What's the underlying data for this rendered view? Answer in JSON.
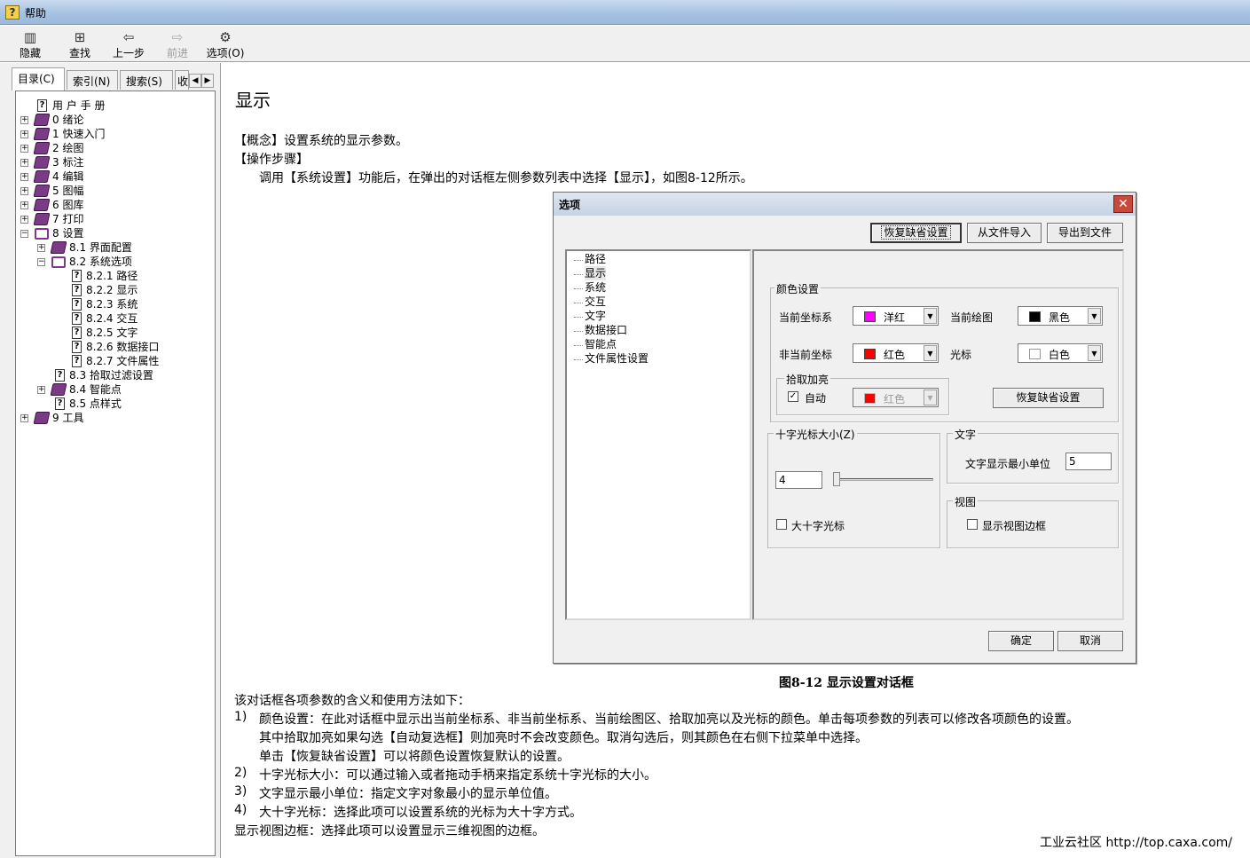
{
  "window": {
    "title": "帮助"
  },
  "toolbar": {
    "hide": "隐藏",
    "find": "查找",
    "back": "上一步",
    "forward": "前进",
    "options": "选项(O)"
  },
  "left_tabs": {
    "contents": "目录(C)",
    "index": "索引(N)",
    "search": "搜索(S)",
    "favorites": "收"
  },
  "tree": [
    {
      "label": "用 户 手 册"
    },
    {
      "label": "0 绪论"
    },
    {
      "label": "1 快速入门"
    },
    {
      "label": "2 绘图"
    },
    {
      "label": "3 标注"
    },
    {
      "label": "4 编辑"
    },
    {
      "label": "5 图幅"
    },
    {
      "label": "6 图库"
    },
    {
      "label": "7 打印"
    },
    {
      "label": "8 设置"
    },
    {
      "label": "8.1 界面配置"
    },
    {
      "label": "8.2 系统选项"
    },
    {
      "label": "8.2.1 路径"
    },
    {
      "label": "8.2.2 显示"
    },
    {
      "label": "8.2.3 系统"
    },
    {
      "label": "8.2.4 交互"
    },
    {
      "label": "8.2.5 文字"
    },
    {
      "label": "8.2.6 数据接口"
    },
    {
      "label": "8.2.7 文件属性"
    },
    {
      "label": "8.3 拾取过滤设置"
    },
    {
      "label": "8.4 智能点"
    },
    {
      "label": "8.5 点样式"
    },
    {
      "label": "9 工具"
    }
  ],
  "page": {
    "title": "显示",
    "concept": "【概念】设置系统的显示参数。",
    "steps_head": "【操作步骤】",
    "steps_text": "调用【系统设置】功能后，在弹出的对话框左侧参数列表中选择【显示】，如图8-12所示。",
    "figure_caption": "图8-12 显示设置对话框",
    "intro": "该对话框各项参数的含义和使用方法如下：",
    "items": [
      {
        "num": "1)",
        "text": "颜色设置：在此对话框中显示出当前坐标系、非当前坐标系、当前绘图区、拾取加亮以及光标的颜色。单击每项参数的列表可以修改各项颜色的设置。"
      },
      {
        "num": "",
        "text": "其中拾取加亮如果勾选【自动复选框】则加亮时不会改变颜色。取消勾选后，则其颜色在右侧下拉菜单中选择。"
      },
      {
        "num": "",
        "text": "单击【恢复缺省设置】可以将颜色设置恢复默认的设置。"
      },
      {
        "num": "2)",
        "text": "十字光标大小：可以通过输入或者拖动手柄来指定系统十字光标的大小。"
      },
      {
        "num": "3)",
        "text": "文字显示最小单位：指定文字对象最小的显示单位值。"
      },
      {
        "num": "4)",
        "text": "大十字光标：选择此项可以设置系统的光标为大十字方式。"
      }
    ],
    "last_line": "显示视图边框：选择此项可以设置显示三维视图的边框。",
    "watermark": "工业云社区 http://top.caxa.com/"
  },
  "dialog": {
    "title": "选项",
    "restore_defaults": "恢复缺省设置",
    "import": "从文件导入",
    "export": "导出到文件",
    "list": [
      "路径",
      "显示",
      "系统",
      "交互",
      "文字",
      "数据接口",
      "智能点",
      "文件属性设置"
    ],
    "color_group": "颜色设置",
    "current_ucs_label": "当前坐标系",
    "current_ucs_value": "洋红",
    "current_ucs_color": "#ff00ff",
    "current_draw_label": "当前绘图",
    "current_draw_value": "黑色",
    "current_draw_color": "#000000",
    "noncurrent_ucs_label": "非当前坐标",
    "noncurrent_ucs_value": "红色",
    "noncurrent_ucs_color": "#ff0000",
    "cursor_label": "光标",
    "cursor_value": "白色",
    "cursor_color": "#ffffff",
    "pick_group": "拾取加亮",
    "auto_label": "自动",
    "pick_value": "红色",
    "restore_colors": "恢复缺省设置",
    "crosshair_group": "十字光标大小(Z)",
    "crosshair_value": "4",
    "big_cross_label": "大十字光标",
    "text_group": "文字",
    "text_min_label": "文字显示最小单位",
    "text_min_value": "5",
    "view_group": "视图",
    "view_border_label": "显示视图边框",
    "ok": "确定",
    "cancel": "取消"
  }
}
